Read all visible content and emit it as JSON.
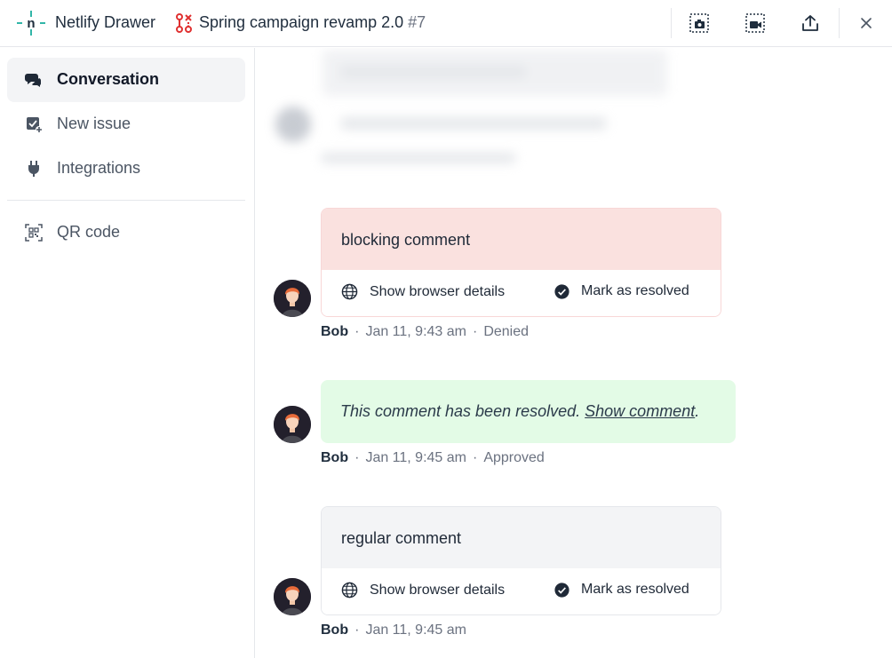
{
  "header": {
    "app_title": "Netlify Drawer",
    "mr_title": "Spring campaign revamp 2.0",
    "mr_number": "#7",
    "buttons": [
      "screenshot-icon",
      "record-video-icon",
      "share-icon",
      "close-icon"
    ]
  },
  "sidebar": {
    "items": [
      {
        "label": "Conversation",
        "icon": "chat-bubbles-icon",
        "active": true
      },
      {
        "label": "New issue",
        "icon": "new-issue-icon",
        "active": false
      },
      {
        "label": "Integrations",
        "icon": "plug-icon",
        "active": false
      },
      {
        "label": "QR code",
        "icon": "qr-code-icon",
        "active": false
      }
    ]
  },
  "comments": [
    {
      "text": "blocking comment",
      "kind": "blocking",
      "actions": {
        "details": "Show browser details",
        "resolve": "Mark as resolved"
      },
      "author": "Bob",
      "time": "Jan 11, 9:43 am",
      "status": "Denied"
    },
    {
      "kind": "resolved",
      "resolved_text": "This comment has been resolved.",
      "show_link": "Show comment",
      "trailing": ".",
      "author": "Bob",
      "time": "Jan 11, 9:45 am",
      "status": "Approved"
    },
    {
      "text": "regular comment",
      "kind": "regular",
      "actions": {
        "details": "Show browser details",
        "resolve": "Mark as resolved"
      },
      "author": "Bob",
      "time": "Jan 11, 9:45 am"
    }
  ],
  "meta_separator": "·",
  "colors": {
    "blocking_bg": "#fae1df",
    "resolved_bg": "#e3fbe6",
    "regular_bg": "#f3f4f6",
    "brand": "#32b6a8"
  }
}
